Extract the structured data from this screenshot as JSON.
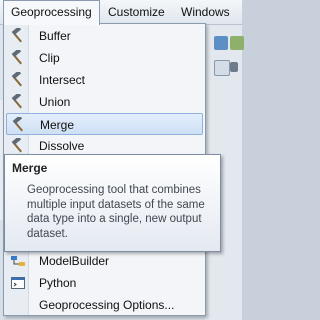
{
  "menubar": {
    "items": [
      {
        "label": "Geoprocessing",
        "active": true
      },
      {
        "label": "Customize",
        "active": false
      },
      {
        "label": "Windows",
        "active": false
      }
    ]
  },
  "menu": {
    "items": [
      {
        "label": "Buffer",
        "icon": "hammer-icon"
      },
      {
        "label": "Clip",
        "icon": "hammer-icon"
      },
      {
        "label": "Intersect",
        "icon": "hammer-icon"
      },
      {
        "label": "Union",
        "icon": "hammer-icon"
      },
      {
        "label": "Merge",
        "icon": "hammer-icon",
        "highlighted": true
      },
      {
        "label": "Dissolve",
        "icon": "hammer-icon"
      },
      {
        "label": "ModelBuilder",
        "icon": "modelbuilder-icon"
      },
      {
        "label": "Python",
        "icon": "python-window-icon"
      },
      {
        "label": "Geoprocessing Options...",
        "icon": ""
      }
    ]
  },
  "tooltip": {
    "title": "Merge",
    "body": "Geoprocessing tool that combines multiple input datasets of the same data type into a single, new output dataset."
  },
  "colors": {
    "highlight": "#cfe0f5",
    "menu_background": "#f3f5f8",
    "tooltip_title": "#222222",
    "tooltip_body": "#404850"
  }
}
